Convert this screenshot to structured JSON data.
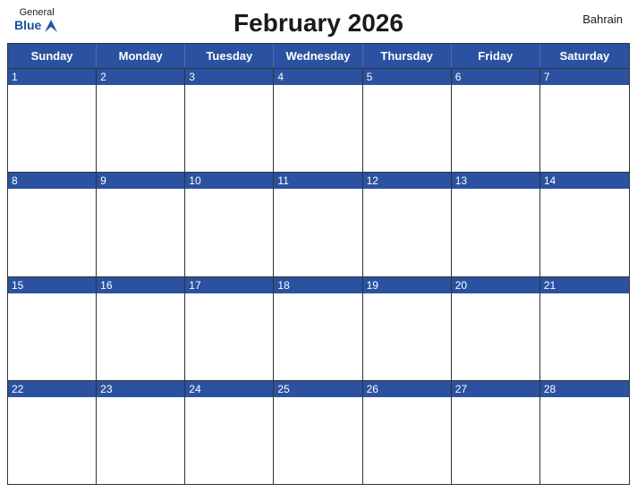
{
  "header": {
    "logo_general": "General",
    "logo_blue": "Blue",
    "title": "February 2026",
    "country": "Bahrain"
  },
  "calendar": {
    "days_of_week": [
      "Sunday",
      "Monday",
      "Tuesday",
      "Wednesday",
      "Thursday",
      "Friday",
      "Saturday"
    ],
    "weeks": [
      [
        {
          "number": "1",
          "empty": false
        },
        {
          "number": "2",
          "empty": false
        },
        {
          "number": "3",
          "empty": false
        },
        {
          "number": "4",
          "empty": false
        },
        {
          "number": "5",
          "empty": false
        },
        {
          "number": "6",
          "empty": false
        },
        {
          "number": "7",
          "empty": false
        }
      ],
      [
        {
          "number": "8",
          "empty": false
        },
        {
          "number": "9",
          "empty": false
        },
        {
          "number": "10",
          "empty": false
        },
        {
          "number": "11",
          "empty": false
        },
        {
          "number": "12",
          "empty": false
        },
        {
          "number": "13",
          "empty": false
        },
        {
          "number": "14",
          "empty": false
        }
      ],
      [
        {
          "number": "15",
          "empty": false
        },
        {
          "number": "16",
          "empty": false
        },
        {
          "number": "17",
          "empty": false
        },
        {
          "number": "18",
          "empty": false
        },
        {
          "number": "19",
          "empty": false
        },
        {
          "number": "20",
          "empty": false
        },
        {
          "number": "21",
          "empty": false
        }
      ],
      [
        {
          "number": "22",
          "empty": false
        },
        {
          "number": "23",
          "empty": false
        },
        {
          "number": "24",
          "empty": false
        },
        {
          "number": "25",
          "empty": false
        },
        {
          "number": "26",
          "empty": false
        },
        {
          "number": "27",
          "empty": false
        },
        {
          "number": "28",
          "empty": false
        }
      ]
    ]
  }
}
